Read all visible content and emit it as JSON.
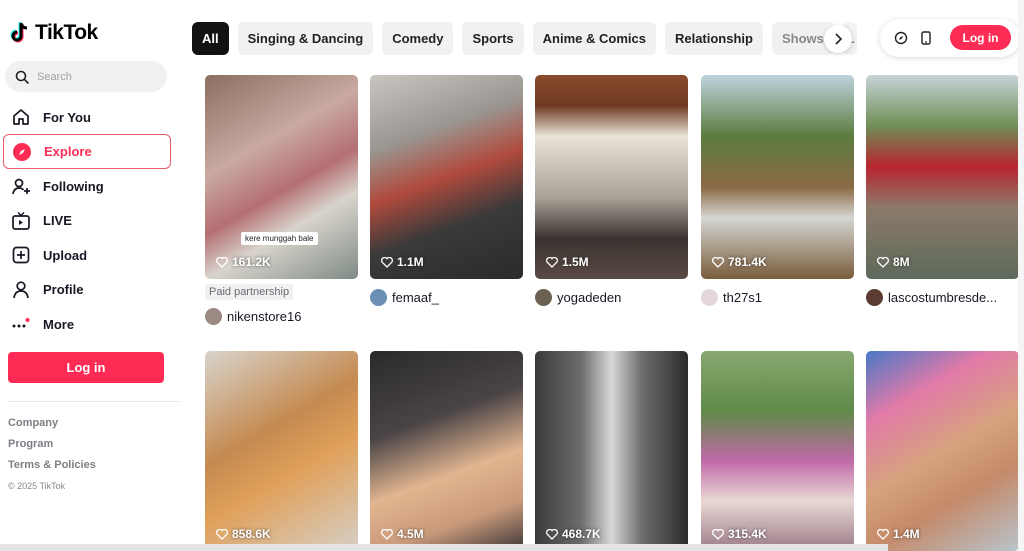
{
  "app": {
    "name": "TikTok"
  },
  "search": {
    "placeholder": "Search"
  },
  "nav": [
    {
      "label": "For You",
      "icon": "home-icon"
    },
    {
      "label": "Explore",
      "icon": "compass-icon",
      "active": true
    },
    {
      "label": "Following",
      "icon": "user-plus-icon"
    },
    {
      "label": "LIVE",
      "icon": "live-tv-icon"
    },
    {
      "label": "Upload",
      "icon": "plus-square-icon"
    },
    {
      "label": "Profile",
      "icon": "user-icon"
    },
    {
      "label": "More",
      "icon": "more-dots-icon"
    }
  ],
  "login_label": "Log in",
  "footer": {
    "company": "Company",
    "program": "Program",
    "terms": "Terms & Policies",
    "copyright": "© 2025 TikTok"
  },
  "categories": [
    "All",
    "Singing & Dancing",
    "Comedy",
    "Sports",
    "Anime & Comics",
    "Relationship",
    "Shows",
    "L"
  ],
  "accent_color": "#fe2c55",
  "videos": [
    {
      "count": "161.2K",
      "caption_overlay": "kere munggah bale",
      "badge": "Paid partnership",
      "author": "nikenstore16"
    },
    {
      "count": "1.1M",
      "author": "femaaf_"
    },
    {
      "count": "1.5M",
      "author": "yogadeden"
    },
    {
      "count": "781.4K",
      "author": "th27s1"
    },
    {
      "count": "8M",
      "author": "lascostumbresde..."
    },
    {
      "count": "858.6K"
    },
    {
      "count": "4.5M"
    },
    {
      "count": "468.7K"
    },
    {
      "count": "315.4K"
    },
    {
      "count": "1.4M"
    }
  ]
}
